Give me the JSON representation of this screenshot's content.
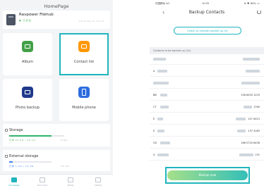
{
  "left": {
    "title": "HomePage",
    "device": {
      "name": "Ravpower Filehub",
      "status": "● 已连接",
      "time": "2019-08-22 10:15"
    },
    "tiles": [
      {
        "label": "Album",
        "icon": "album-icon"
      },
      {
        "label": "Contact list",
        "icon": "contact-list-icon"
      },
      {
        "label": "Photo backup",
        "icon": "photo-backup-icon"
      },
      {
        "label": "Mobile phone",
        "icon": "mobile-phone-icon"
      }
    ],
    "storage": {
      "title": "Storage",
      "used": "已用 22.5G / 29.1G",
      "free": "6.6G",
      "progress": 0.77
    },
    "external_storage": {
      "title": "External storage",
      "used": "已用 1.2G / 14.3G",
      "free": "13.1G",
      "progress": 0.08
    },
    "tabbar": [
      "Homepage",
      "Document",
      "Media",
      "Setting"
    ],
    "colors": {
      "accent": "#1fb5bd",
      "green": "#43a047",
      "orange": "#ff9800",
      "navy": "#1f3a8a",
      "blue": "#2d6cdf"
    }
  },
  "right": {
    "status": {
      "left": "中国移动 4G",
      "time": "10:55",
      "right": "⊕ ♥ 86% ▭"
    },
    "title": "Backup Contacts",
    "back": "‹",
    "check_button": "Check to already backed up (0)",
    "list_header": "Contacts to be backed up (14)",
    "rows": [
      {
        "name": "",
        "phone": ""
      },
      {
        "name": "A",
        "phone": ""
      },
      {
        "name": "",
        "phone": ""
      },
      {
        "name": "BB",
        "phone": "158 8450 1229"
      },
      {
        "name": "CT",
        "phone": "1760"
      },
      {
        "name": "E",
        "phone": "157 6413"
      },
      {
        "name": "E",
        "phone": "137 4183"
      },
      {
        "name": "GS",
        "phone": "186 0720 8438"
      },
      {
        "name": "X",
        "phone": "131"
      }
    ],
    "backup_button": "Backup now"
  }
}
